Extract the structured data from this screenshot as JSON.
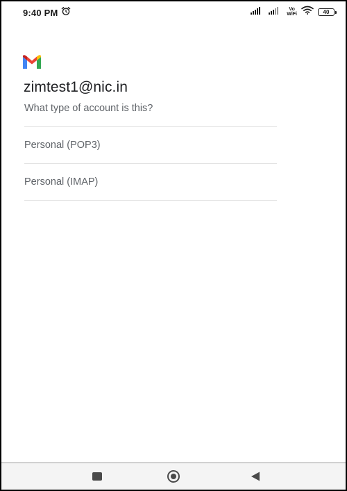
{
  "status_bar": {
    "time": "9:40 PM",
    "alarm_icon": "alarm-clock-icon",
    "wifi_label_top": "Vo",
    "wifi_label_bottom": "WiFi",
    "battery_level": "40"
  },
  "account": {
    "app_icon": "gmail-icon",
    "email": "zimtest1@nic.in",
    "question": "What type of account is this?"
  },
  "options": [
    {
      "label": "Personal (POP3)"
    },
    {
      "label": "Personal (IMAP)"
    }
  ],
  "nav_bar": {
    "recents_icon": "recents-square-icon",
    "home_icon": "home-circle-icon",
    "back_icon": "back-triangle-icon"
  },
  "colors": {
    "title_text": "#202124",
    "secondary_text": "#5f6368",
    "divider": "#e3e3e3",
    "gmail_blue": "#4285F4",
    "gmail_red": "#EA4335",
    "gmail_yellow": "#FBBC04",
    "gmail_green": "#34A853"
  }
}
